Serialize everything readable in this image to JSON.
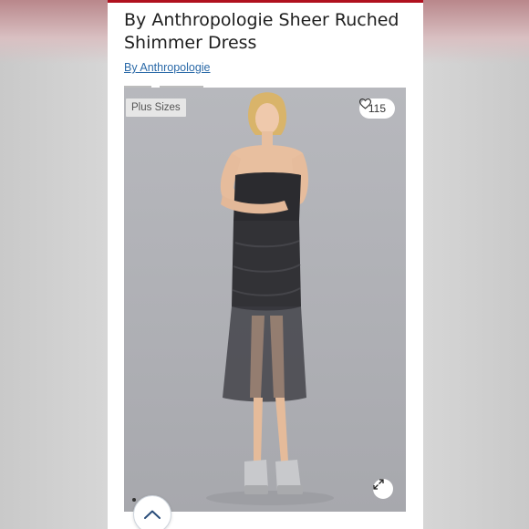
{
  "listing": {
    "title": "By Anthropologie Sheer Ruched Shimmer Dress",
    "brand": "By Anthropologie",
    "size_badge": "Plus Sizes",
    "like_count": "115"
  },
  "icons": {
    "like": "heart-outline-icon",
    "expand": "expand-arrows-icon",
    "scroll_top": "chevron-up-icon"
  },
  "colors": {
    "accent": "#b0101e",
    "link": "#2b6aa8",
    "photo_background": "#b1b2b7",
    "dress": "#2b2b2f"
  },
  "carousel": {
    "current_index": 1
  }
}
